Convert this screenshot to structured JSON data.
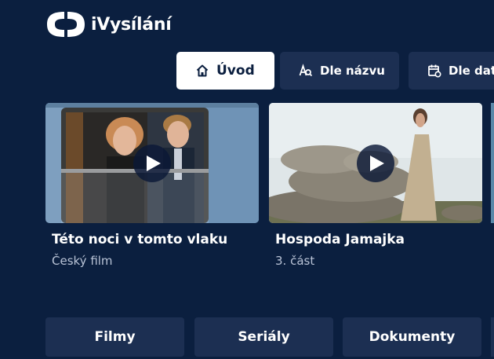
{
  "logo": {
    "text": "iVysílání"
  },
  "tabs": [
    {
      "label": "Úvod",
      "icon": "home-icon",
      "active": true
    },
    {
      "label": "Dle názvu",
      "icon": "search-by-name-icon",
      "active": false
    },
    {
      "label": "Dle data",
      "icon": "calendar-icon",
      "active": false
    }
  ],
  "featured": [
    {
      "title": "Této noci v tomto vlaku",
      "subtitle": "Český film",
      "icon": "play-icon"
    },
    {
      "title": "Hospoda Jamajka",
      "subtitle": "3. část",
      "icon": "play-icon"
    }
  ],
  "genres": [
    {
      "label": "Filmy"
    },
    {
      "label": "Seriály"
    },
    {
      "label": "Dokumenty"
    }
  ],
  "colors": {
    "background": "#0b1f3f",
    "tile": "#1c2f52",
    "active_tab": "#ffffff",
    "subtitle": "#b9c3d6"
  }
}
